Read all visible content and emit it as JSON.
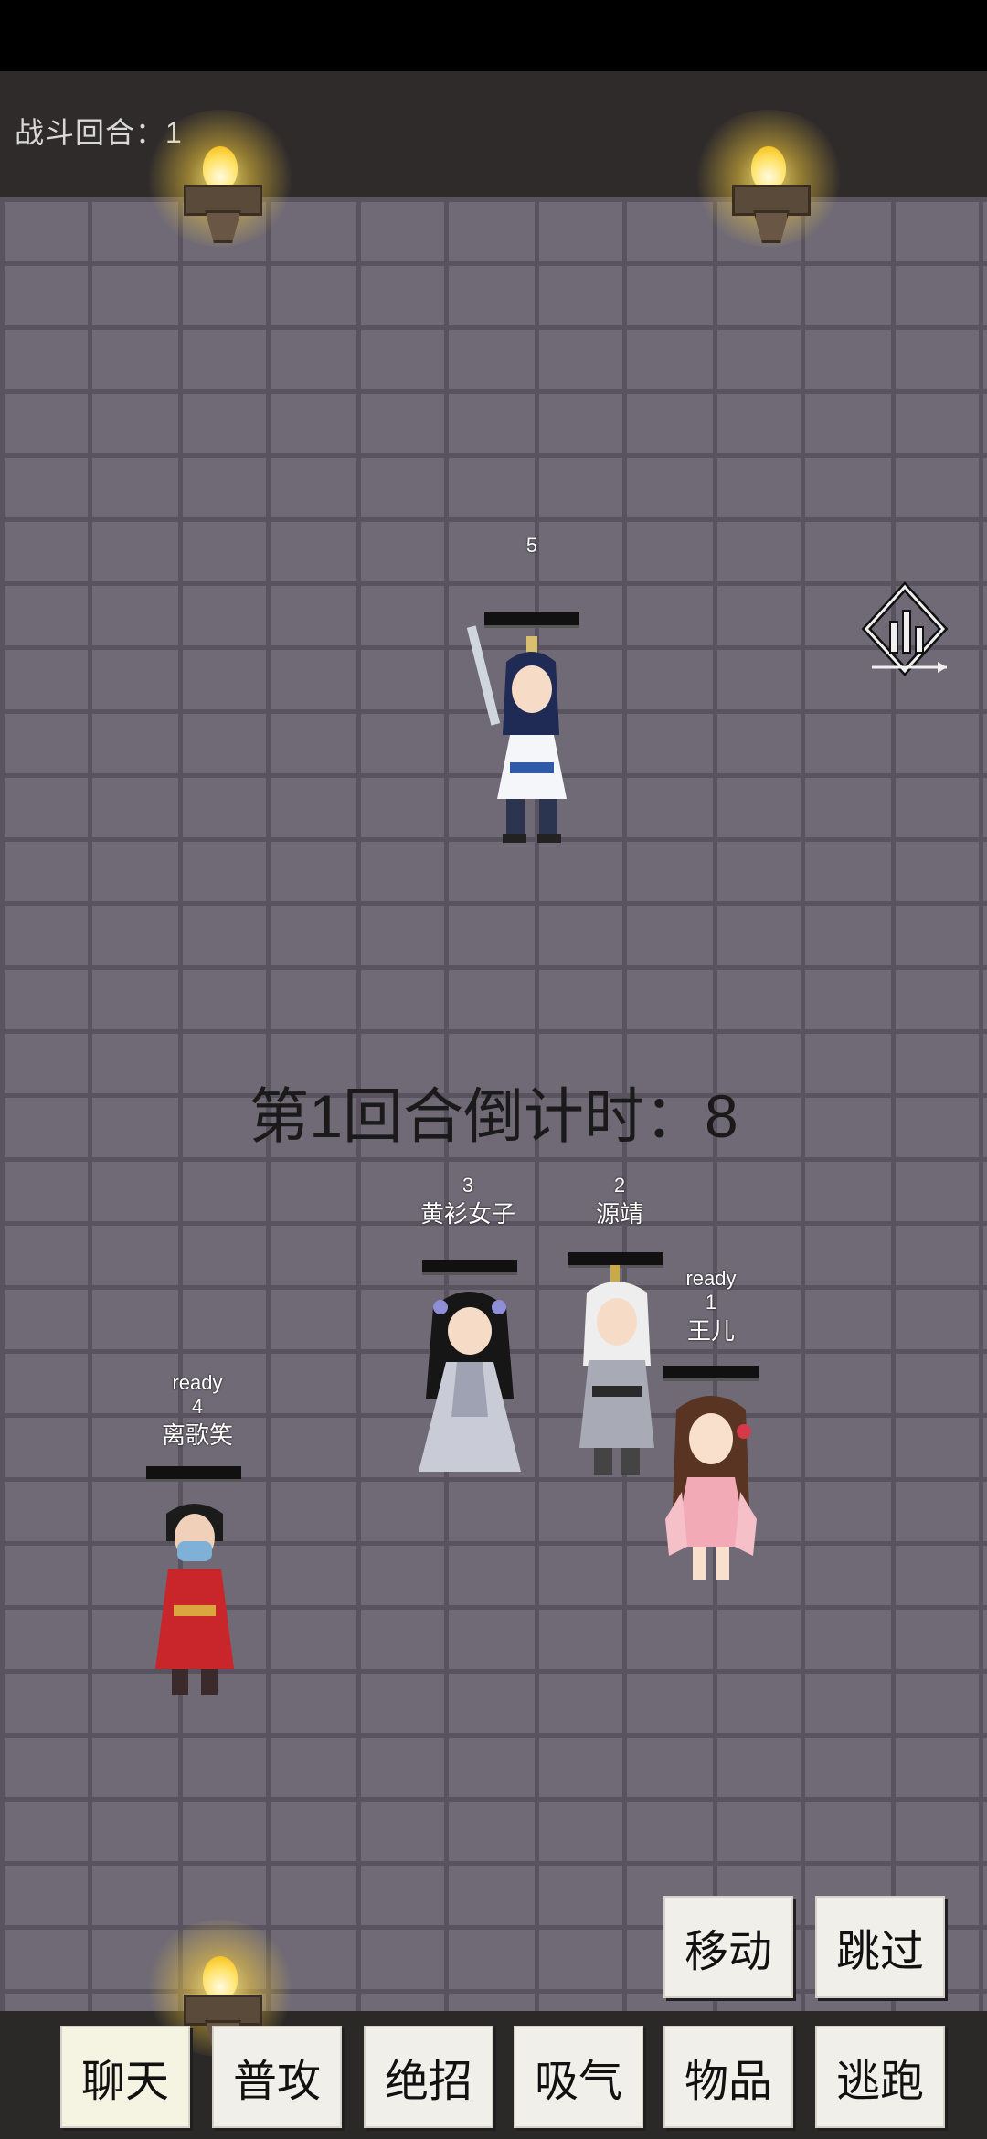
{
  "header": {
    "round_label": "战斗回合：1"
  },
  "countdown": "第1回合倒计时：8",
  "enemy": {
    "order": "5"
  },
  "allies": [
    {
      "order": "3",
      "name": "黄衫女子"
    },
    {
      "order": "2",
      "name": "源靖"
    },
    {
      "ready": "ready",
      "order": "1",
      "name": "王儿"
    },
    {
      "ready": "ready",
      "order": "4",
      "name": "离歌笑"
    }
  ],
  "actions": {
    "move": "移动",
    "skip": "跳过"
  },
  "menu": {
    "chat": "聊天",
    "attack": "普攻",
    "ultimate": "绝招",
    "breath": "吸气",
    "items": "物品",
    "flee": "逃跑"
  },
  "colors": {
    "wall": "#6f6a75",
    "mortar": "#58535e",
    "panel": "#2f2b2b",
    "button": "#f1efe9"
  }
}
